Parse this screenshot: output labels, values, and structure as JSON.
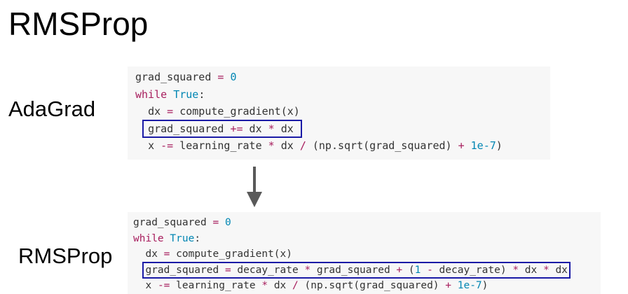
{
  "slide": {
    "title": "RMSProp"
  },
  "adagrad": {
    "label": "AdaGrad",
    "lines": [
      {
        "indent": "",
        "tokens": [
          {
            "t": "grad_squared ",
            "c": "ident"
          },
          {
            "t": "=",
            "c": "op"
          },
          {
            "t": " ",
            "c": "ident"
          },
          {
            "t": "0",
            "c": "num"
          }
        ]
      },
      {
        "indent": "",
        "tokens": [
          {
            "t": "while",
            "c": "kw"
          },
          {
            "t": " ",
            "c": "ident"
          },
          {
            "t": "True",
            "c": "num"
          },
          {
            "t": ":",
            "c": "ident"
          }
        ]
      },
      {
        "indent": "  ",
        "tokens": [
          {
            "t": "dx ",
            "c": "ident"
          },
          {
            "t": "=",
            "c": "op"
          },
          {
            "t": " compute_gradient(x)",
            "c": "ident"
          }
        ]
      },
      {
        "indent": "  ",
        "boxed": true,
        "tokens": [
          {
            "t": "grad_squared ",
            "c": "ident"
          },
          {
            "t": "+=",
            "c": "op"
          },
          {
            "t": " dx ",
            "c": "ident"
          },
          {
            "t": "*",
            "c": "op"
          },
          {
            "t": " dx",
            "c": "ident"
          }
        ]
      },
      {
        "indent": "  ",
        "tokens": [
          {
            "t": "x ",
            "c": "ident"
          },
          {
            "t": "-=",
            "c": "op"
          },
          {
            "t": " learning_rate ",
            "c": "ident"
          },
          {
            "t": "*",
            "c": "op"
          },
          {
            "t": " dx ",
            "c": "ident"
          },
          {
            "t": "/",
            "c": "op"
          },
          {
            "t": " (np.sqrt(grad_squared) ",
            "c": "ident"
          },
          {
            "t": "+",
            "c": "op"
          },
          {
            "t": " ",
            "c": "ident"
          },
          {
            "t": "1e-7",
            "c": "num"
          },
          {
            "t": ")",
            "c": "ident"
          }
        ]
      }
    ]
  },
  "rmsprop": {
    "label": "RMSProp",
    "lines": [
      {
        "indent": "",
        "tokens": [
          {
            "t": "grad_squared ",
            "c": "ident"
          },
          {
            "t": "=",
            "c": "op"
          },
          {
            "t": " ",
            "c": "ident"
          },
          {
            "t": "0",
            "c": "num"
          }
        ]
      },
      {
        "indent": "",
        "tokens": [
          {
            "t": "while",
            "c": "kw"
          },
          {
            "t": " ",
            "c": "ident"
          },
          {
            "t": "True",
            "c": "num"
          },
          {
            "t": ":",
            "c": "ident"
          }
        ]
      },
      {
        "indent": "  ",
        "tokens": [
          {
            "t": "dx ",
            "c": "ident"
          },
          {
            "t": "=",
            "c": "op"
          },
          {
            "t": " compute_gradient(x)",
            "c": "ident"
          }
        ]
      },
      {
        "indent": "  ",
        "boxed": true,
        "tokens": [
          {
            "t": "grad_squared ",
            "c": "ident"
          },
          {
            "t": "=",
            "c": "op"
          },
          {
            "t": " decay_rate ",
            "c": "ident"
          },
          {
            "t": "*",
            "c": "op"
          },
          {
            "t": " grad_squared ",
            "c": "ident"
          },
          {
            "t": "+",
            "c": "op"
          },
          {
            "t": " (",
            "c": "ident"
          },
          {
            "t": "1",
            "c": "num"
          },
          {
            "t": " ",
            "c": "ident"
          },
          {
            "t": "-",
            "c": "op"
          },
          {
            "t": " decay_rate) ",
            "c": "ident"
          },
          {
            "t": "*",
            "c": "op"
          },
          {
            "t": " dx ",
            "c": "ident"
          },
          {
            "t": "*",
            "c": "op"
          },
          {
            "t": " dx",
            "c": "ident"
          }
        ]
      },
      {
        "indent": "  ",
        "tokens": [
          {
            "t": "x ",
            "c": "ident"
          },
          {
            "t": "-=",
            "c": "op"
          },
          {
            "t": " learning_rate ",
            "c": "ident"
          },
          {
            "t": "*",
            "c": "op"
          },
          {
            "t": " dx ",
            "c": "ident"
          },
          {
            "t": "/",
            "c": "op"
          },
          {
            "t": " (np.sqrt(grad_squared) ",
            "c": "ident"
          },
          {
            "t": "+",
            "c": "op"
          },
          {
            "t": " ",
            "c": "ident"
          },
          {
            "t": "1e-7",
            "c": "num"
          },
          {
            "t": ")",
            "c": "ident"
          }
        ]
      }
    ]
  },
  "arrow": {
    "icon": "arrow-down-icon",
    "color": "#595959"
  },
  "colors": {
    "keyword": "#a71d5d",
    "number": "#0086b3",
    "highlight_box": "#1a1aa6",
    "code_background": "#f7f7f7"
  }
}
